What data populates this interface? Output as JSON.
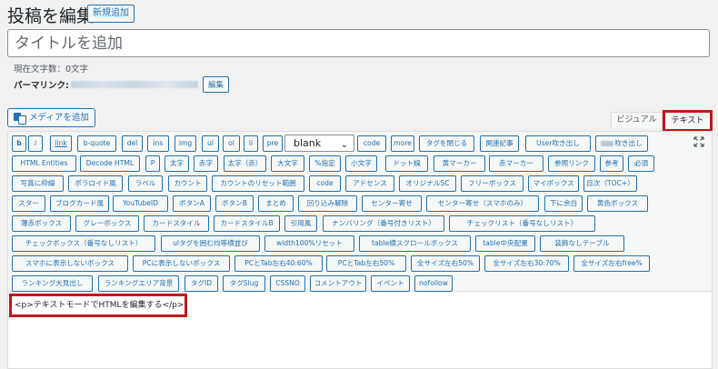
{
  "page": {
    "title": "投稿を編集",
    "add_new": "新規追加"
  },
  "title_field": {
    "placeholder": "タイトルを追加",
    "value": ""
  },
  "meta": {
    "char_count": "現在文字数：0文字",
    "permalink_label": "パーマリンク:",
    "permalink_edit": "編集"
  },
  "media": {
    "label": "メディアを追加",
    "icon": "media-icon"
  },
  "tabs": {
    "visual": "ビジュアル",
    "text": "テキスト"
  },
  "toolbar": {
    "rows": [
      [
        "b",
        "i",
        "link",
        "b-quote",
        "del",
        "ins",
        "img",
        "ul",
        "ol",
        "li",
        "pre",
        "code",
        "more",
        "タグを閉じる",
        "関連記事",
        "User吹き出し",
        "吹き出し"
      ],
      [
        "HTML Entities",
        "Decode HTML",
        "P",
        "太字",
        "赤字",
        "太字（赤）",
        "大文字",
        "%指定",
        "小文字",
        "ドット線",
        "黄マーカー",
        "赤マーカー",
        "参照リンク",
        "参考",
        "必須"
      ],
      [
        "写真に枠線",
        "ポラロイド風",
        "ラベル",
        "カウント",
        "カウントのリセット範囲",
        "code",
        "アドセンス",
        "オリジナルSC",
        "フリーボックス",
        "マイボックス",
        "目次（TOC+）"
      ],
      [
        "スター",
        "ブログカード風",
        "YouTubeID",
        "ボタンA",
        "ボタンB",
        "まとめ",
        "回り込み解除",
        "センター寄せ",
        "センター寄せ（スマホのみ）",
        "下に余白",
        "黄色ボックス"
      ],
      [
        "薄赤ボックス",
        "グレーボックス",
        "カードスタイル",
        "カードスタイルB",
        "引用風",
        "ナンバリング（番号付きリスト）",
        "チェックリスト（番号なしリスト）"
      ],
      [
        "チェックボックス（番号なしリスト）",
        "ulタグを囲む均等横並び",
        "width100%リセット",
        "table横スクロールボックス",
        "table中央配置",
        "装飾なしテーブル"
      ],
      [
        "スマホに表示しないボックス",
        "PCに表示しないボックス",
        "PCとTab左右40:60%",
        "PCとTab左右50%",
        "全サイズ左右50%",
        "全サイズ左右30:70%",
        "全サイズ左右free%"
      ],
      [
        "ランキング大見出し",
        "ランキングエリア背景",
        "タグID",
        "タグSlug",
        "CSSNO",
        "コメントアウト",
        "イベント",
        "nofollow"
      ]
    ],
    "select_value": "blank",
    "fullscreen_icon": "fullscreen-icon"
  },
  "editor": {
    "content": "<p>テキストモードでHTMLを編集する</p>"
  },
  "colors": {
    "accent": "#2271b1",
    "highlight": "#c4161c",
    "background": "#f1f1f1"
  }
}
